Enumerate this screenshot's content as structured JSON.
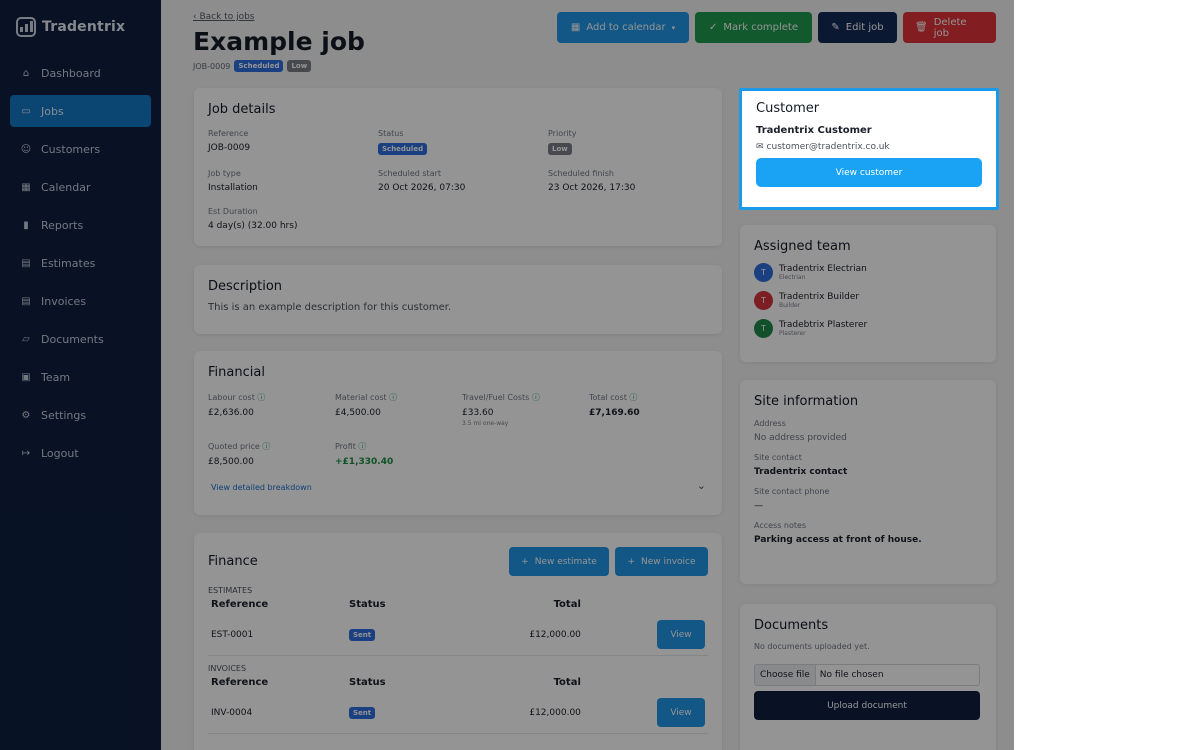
{
  "brand": {
    "name": "Tradentrix"
  },
  "nav": [
    {
      "label": "Dashboard",
      "icon": "dashboard-icon",
      "glyph": "⌂"
    },
    {
      "label": "Jobs",
      "icon": "jobs-icon",
      "glyph": "▭",
      "active": true
    },
    {
      "label": "Customers",
      "icon": "customers-icon",
      "glyph": "☺"
    },
    {
      "label": "Calendar",
      "icon": "calendar-icon",
      "glyph": "▦"
    },
    {
      "label": "Reports",
      "icon": "reports-icon",
      "glyph": "▮"
    },
    {
      "label": "Estimates",
      "icon": "estimates-icon",
      "glyph": "▤"
    },
    {
      "label": "Invoices",
      "icon": "invoices-icon",
      "glyph": "▤"
    },
    {
      "label": "Documents",
      "icon": "documents-icon",
      "glyph": "▱"
    },
    {
      "label": "Team",
      "icon": "team-icon",
      "glyph": "▣"
    },
    {
      "label": "Settings",
      "icon": "settings-icon",
      "glyph": "⚙"
    },
    {
      "label": "Logout",
      "icon": "logout-icon",
      "glyph": "↦"
    }
  ],
  "header": {
    "back_label": "Back to jobs",
    "title": "Example job",
    "job_ref": "JOB-0009",
    "status_badge": "Scheduled",
    "priority_badge": "Low"
  },
  "actions": {
    "add_calendar": "Add to calendar",
    "mark_complete": "Mark complete",
    "edit_job": "Edit job",
    "delete_job": "Delete job"
  },
  "job_details": {
    "heading": "Job details",
    "fields": [
      {
        "label": "Reference",
        "value": "JOB-0009"
      },
      {
        "label": "Status",
        "value": "Scheduled",
        "badge": "sched"
      },
      {
        "label": "Priority",
        "value": "Low",
        "badge": "low"
      },
      {
        "label": "Job type",
        "value": "Installation"
      },
      {
        "label": "Scheduled start",
        "value": "20 Oct 2026, 07:30"
      },
      {
        "label": "Scheduled finish",
        "value": "23 Oct 2026, 17:30"
      },
      {
        "label": "Est Duration",
        "value": "4 day(s) (32.00 hrs)"
      }
    ]
  },
  "description": {
    "heading": "Description",
    "text": "This is an example description for this customer."
  },
  "financial": {
    "heading": "Financial",
    "items": [
      {
        "label": "Labour cost",
        "value": "£2,636.00"
      },
      {
        "label": "Material cost",
        "value": "£4,500.00"
      },
      {
        "label": "Travel/Fuel Costs",
        "value": "£33.60",
        "sub": "3.5 mi one-way"
      },
      {
        "label": "Total cost",
        "value": "£7,169.60",
        "bold": true
      },
      {
        "label": "Quoted price",
        "value": "£8,500.00"
      },
      {
        "label": "Profit",
        "value": "+£1,330.40",
        "green": true
      }
    ],
    "breakdown_link": "View detailed breakdown"
  },
  "finance": {
    "heading": "Finance",
    "new_estimate": "New estimate",
    "new_invoice": "New invoice",
    "estimates_label": "ESTIMATES",
    "invoices_label": "INVOICES",
    "columns": [
      "Reference",
      "Status",
      "Total"
    ],
    "estimates": [
      {
        "ref": "EST-0001",
        "status": "Sent",
        "total": "£12,000.00",
        "action": "View"
      }
    ],
    "invoices": [
      {
        "ref": "INV-0004",
        "status": "Sent",
        "total": "£12,000.00",
        "action": "View"
      }
    ]
  },
  "customer": {
    "heading": "Customer",
    "name": "Tradentrix Customer",
    "email": "customer@tradentrix.co.uk",
    "button": "View customer"
  },
  "team": {
    "heading": "Assigned team",
    "members": [
      {
        "initial": "T",
        "name": "Tradentrix Electrian",
        "role": "Electrian",
        "color": "#2e6fe0"
      },
      {
        "initial": "T",
        "name": "Tradentrix Builder",
        "role": "Builder",
        "color": "#d6343c"
      },
      {
        "initial": "T",
        "name": "Tradebtrix Plasterer",
        "role": "Plasterer",
        "color": "#1f8a4c"
      }
    ]
  },
  "site": {
    "heading": "Site information",
    "fields": [
      {
        "label": "Address",
        "value": "No address provided",
        "muted": true
      },
      {
        "label": "Site contact",
        "value": "Tradentrix contact",
        "bold": true
      },
      {
        "label": "Site contact phone",
        "value": "—"
      },
      {
        "label": "Access notes",
        "value": "Parking access at front of house.",
        "bold": true
      }
    ]
  },
  "documents": {
    "heading": "Documents",
    "empty_text": "No documents uploaded yet.",
    "choose_file": "Choose file",
    "no_file": "No file chosen",
    "upload": "Upload document"
  }
}
